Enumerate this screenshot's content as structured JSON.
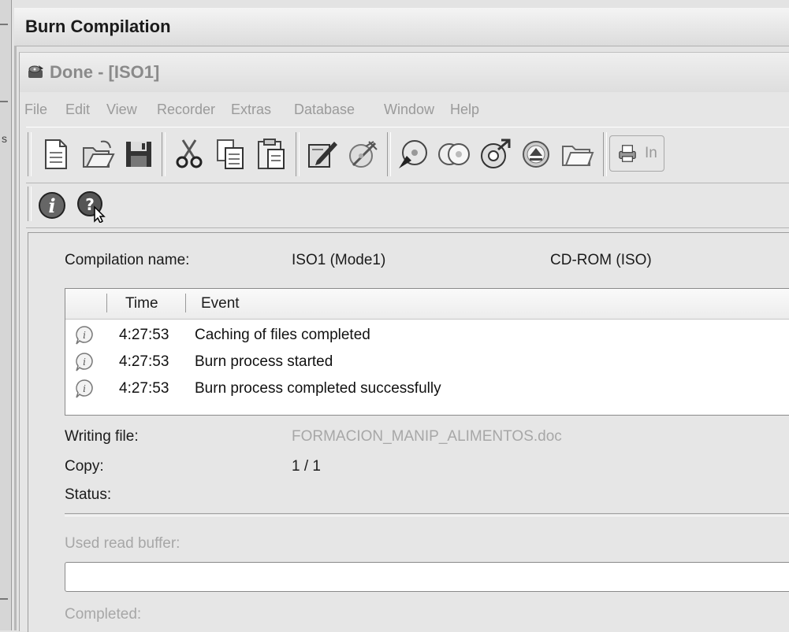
{
  "outer_window": {
    "title": "Burn Compilation",
    "left_fragment": "s"
  },
  "window": {
    "title": "Done - [ISO1]"
  },
  "menu": [
    "File",
    "Edit",
    "View",
    "Recorder",
    "Extras",
    "Database",
    "Window",
    "Help"
  ],
  "toolbar": {
    "icons": [
      "new-document-icon",
      "open-folder-icon",
      "save-disk-icon",
      "cut-scissors-icon",
      "copy-icon",
      "paste-icon",
      "write-compilation-icon",
      "erase-icon",
      "disc-wizard-icon",
      "cd-info-icon",
      "disc-burn-icon",
      "eject-icon",
      "browse-folder-icon",
      "printer-icon"
    ],
    "truncated_label": "In"
  },
  "toolbar2": {
    "icons": [
      "info-icon",
      "help-pointer-icon"
    ]
  },
  "compilation": {
    "name_label": "Compilation name:",
    "name_value": "ISO1 (Mode1)",
    "type_value": "CD-ROM (ISO)"
  },
  "log": {
    "columns": [
      "Time",
      "Event"
    ],
    "rows": [
      {
        "time": "4:27:53",
        "event": "Caching of files completed"
      },
      {
        "time": "4:27:53",
        "event": "Burn process started"
      },
      {
        "time": "4:27:53",
        "event": "Burn process completed successfully"
      }
    ]
  },
  "status": {
    "writing_file_label": "Writing file:",
    "writing_file_value": "FORMACION_MANIP_ALIMENTOS.doc",
    "copy_label": "Copy:",
    "copy_value": "1 / 1",
    "status_label": "Status:"
  },
  "buffer": {
    "label": "Used read buffer:",
    "percent": 0
  },
  "completed": {
    "label": "Completed:"
  }
}
